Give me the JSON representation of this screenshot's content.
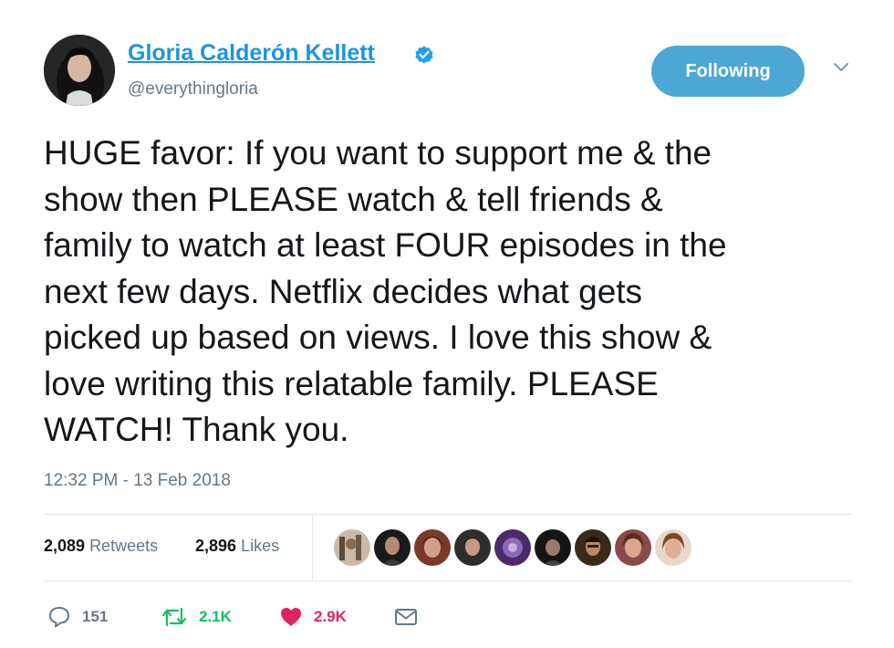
{
  "author": {
    "name": "Gloria Calderón Kellett",
    "handle": "@everythingloria",
    "verified": true
  },
  "follow_button": {
    "label": "Following",
    "color": "#4ca7d5"
  },
  "tweet": {
    "lines": [
      "HUGE favor: If you want to support me & the",
      "show then PLEASE watch & tell friends &",
      "family to watch at least FOUR episodes in the",
      "next few days. Netflix decides what gets",
      "picked up based on views. I love this show &",
      "love writing this relatable family. PLEASE",
      "WATCH! Thank you."
    ],
    "timestamp": "12:32 PM - 13 Feb 2018"
  },
  "stats": {
    "retweets": {
      "count": "2,089",
      "label": "Retweets"
    },
    "likes": {
      "count": "2,896",
      "label": "Likes"
    }
  },
  "actions": {
    "replies": "151",
    "retweets": "2.1K",
    "likes": "2.9K"
  },
  "colors": {
    "link_blue": "#1b95e0",
    "secondary_gray": "#657786",
    "retweet_green": "#17bf63",
    "like_red": "#e0245e"
  }
}
